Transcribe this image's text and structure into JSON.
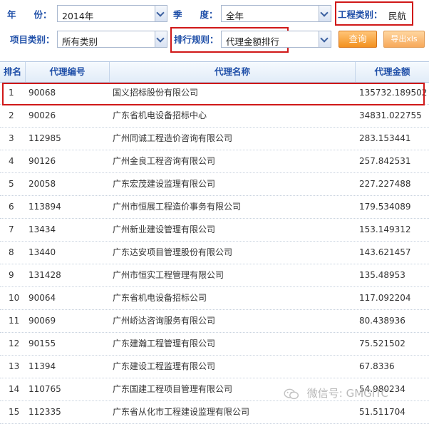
{
  "filters": {
    "year_label": "年　　份：",
    "year_value": "2014年",
    "season_label": "季　　度：",
    "season_value": "全年",
    "project_type_label": "工程类别：",
    "project_type_value": "民航",
    "item_category_label": "项目类别：",
    "item_category_value": "所有类别",
    "rank_rule_label": "排行规则：",
    "rank_rule_value": "代理金额排行",
    "query_button": "查询",
    "export_button": "导出xls"
  },
  "table": {
    "headers": [
      "排名",
      "代理编号",
      "代理名称",
      "代理金额"
    ],
    "rows": [
      {
        "rank": "1",
        "code": "90068",
        "name": "国义招标股份有限公司",
        "amount": "135732.189502"
      },
      {
        "rank": "2",
        "code": "90026",
        "name": "广东省机电设备招标中心",
        "amount": "34831.022755"
      },
      {
        "rank": "3",
        "code": "112985",
        "name": "广州同诚工程造价咨询有限公司",
        "amount": "283.153441"
      },
      {
        "rank": "4",
        "code": "90126",
        "name": "广州金良工程咨询有限公司",
        "amount": "257.842531"
      },
      {
        "rank": "5",
        "code": "20058",
        "name": "广东宏茂建设监理有限公司",
        "amount": "227.227488"
      },
      {
        "rank": "6",
        "code": "113894",
        "name": "广州市恒展工程造价事务有限公司",
        "amount": "179.534089"
      },
      {
        "rank": "7",
        "code": "13434",
        "name": "广州新业建设管理有限公司",
        "amount": "153.149312"
      },
      {
        "rank": "8",
        "code": "13440",
        "name": "广东达安项目管理股份有限公司",
        "amount": "143.621457"
      },
      {
        "rank": "9",
        "code": "131428",
        "name": "广州市恒实工程管理有限公司",
        "amount": "135.48953"
      },
      {
        "rank": "10",
        "code": "90064",
        "name": "广东省机电设备招标公司",
        "amount": "117.092204"
      },
      {
        "rank": "11",
        "code": "90069",
        "name": "广州峤达咨询服务有限公司",
        "amount": "80.438936"
      },
      {
        "rank": "12",
        "code": "90155",
        "name": "广东建瀚工程管理有限公司",
        "amount": "75.521502"
      },
      {
        "rank": "13",
        "code": "11394",
        "name": "广东建设工程监理有限公司",
        "amount": "67.8336"
      },
      {
        "rank": "14",
        "code": "110765",
        "name": "广东国建工程项目管理有限公司",
        "amount": "54.980234"
      },
      {
        "rank": "15",
        "code": "112335",
        "name": "广东省从化市工程建设监理有限公司",
        "amount": "51.511704"
      }
    ]
  },
  "watermark": {
    "text": "微信号: GMGITC",
    "icon": "wechat-icon"
  },
  "colors": {
    "label_blue": "#1f4fa8",
    "highlight_red": "#d01818",
    "button_orange": "#f3911f"
  }
}
